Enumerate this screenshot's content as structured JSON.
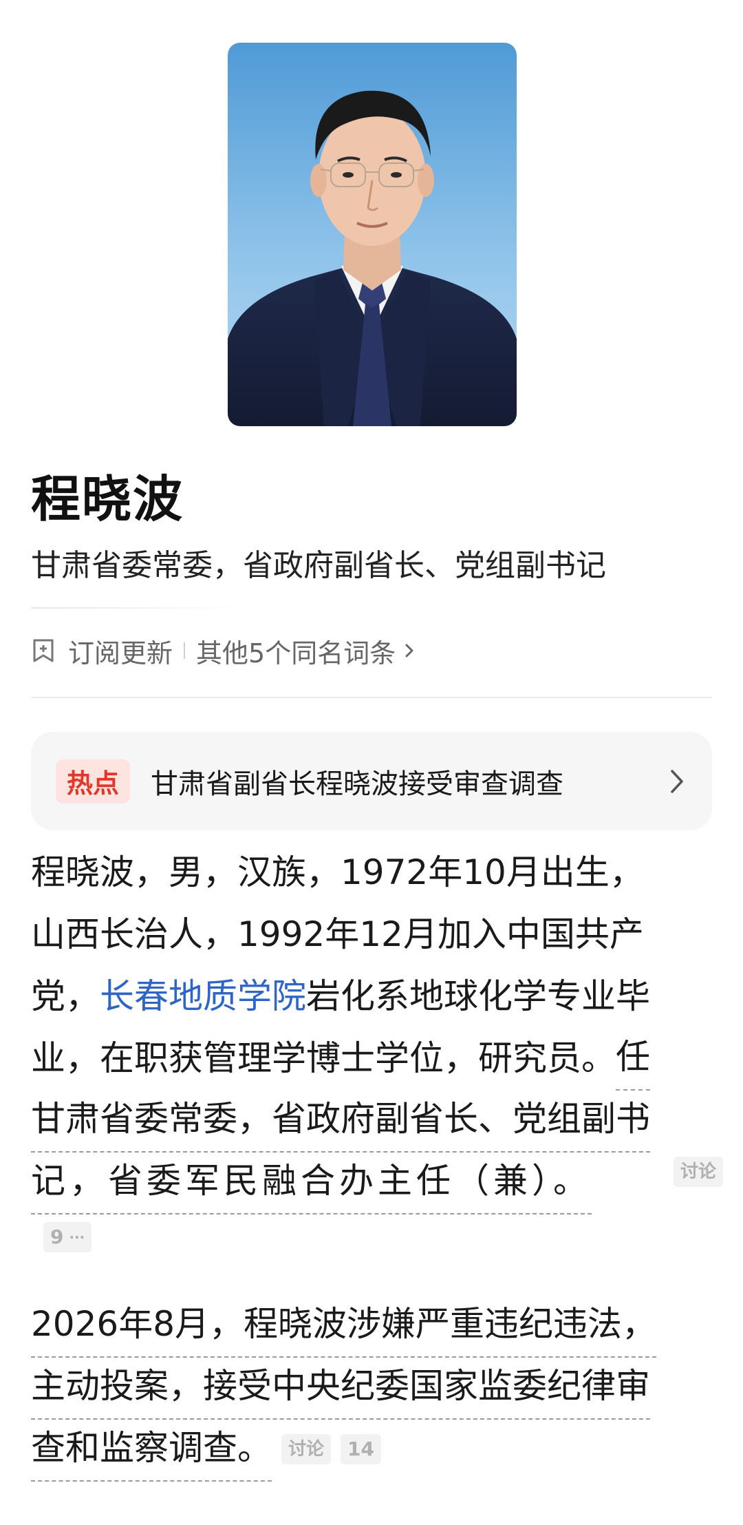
{
  "person": {
    "name": "程晓波",
    "title": "甘肃省委常委，省政府副省长、党组副书记"
  },
  "actions": {
    "subscribe_label": "订阅更新",
    "same_name_label": "其他5个同名词条"
  },
  "hot": {
    "badge": "热点",
    "text": "甘肃省副省长程晓波接受审查调查"
  },
  "intro": {
    "l1": "程晓波，男，汉族，1972年10月出生，",
    "l2": "山西长治人，1992年12月加入中国共产",
    "l3_pre": "党，",
    "l3_link": "长春地质学院",
    "l3_post": "岩化系地球化学专业毕",
    "l4_plain": "业，在职获管理学博士学位，研究员。",
    "l4_ul": "任",
    "l5": "甘肃省委常委，省政府副省长、党组副书",
    "l6": "记，省委军民融合办主任（兼）。",
    "discuss_label": "讨论",
    "count": "9",
    "more": "···"
  },
  "event": {
    "l1": "2026年8月，程晓波涉嫌严重违纪违法，",
    "l2": "主动投案，接受中央纪委国家监委纪律审",
    "l3": "查和监察调查。",
    "discuss_label": "讨论",
    "count": "14"
  },
  "colors": {
    "link": "#2e65c7",
    "hot_badge_bg": "#fde4e1",
    "hot_badge_text": "#e2382a",
    "card_bg": "#f6f6f6"
  }
}
